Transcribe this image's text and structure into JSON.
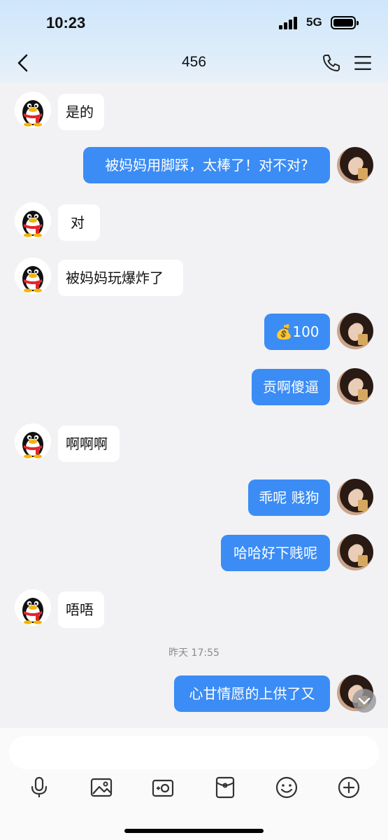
{
  "status": {
    "time": "10:23",
    "network": "5G"
  },
  "header": {
    "title": "456",
    "back_icon": "chevron-left-icon",
    "call_icon": "phone-icon",
    "menu_icon": "menu-icon"
  },
  "messages": [
    {
      "side": "in",
      "text": "是的"
    },
    {
      "side": "out",
      "text": "被妈妈用脚踩，太棒了！对不对?"
    },
    {
      "side": "in",
      "text": "对"
    },
    {
      "side": "in",
      "text": "被妈妈玩爆炸了"
    },
    {
      "side": "out",
      "text": "💰100"
    },
    {
      "side": "out",
      "text": "贡啊傻逼"
    },
    {
      "side": "in",
      "text": "啊啊啊"
    },
    {
      "side": "out",
      "text": "乖呢 贱狗"
    },
    {
      "side": "out",
      "text": "哈哈好下贱呢"
    },
    {
      "side": "in",
      "text": "唔唔"
    },
    {
      "side": "out",
      "text": "心甘情愿的上供了又"
    }
  ],
  "timestamp": "昨天 17:55",
  "toolbar": [
    "microphone-icon",
    "image-icon",
    "camera-icon",
    "red-packet-icon",
    "emoji-icon",
    "plus-icon"
  ],
  "colors": {
    "accent": "#3b8cf5",
    "background": "#f2f2f4",
    "header_gradient": "#cfe6fb"
  }
}
